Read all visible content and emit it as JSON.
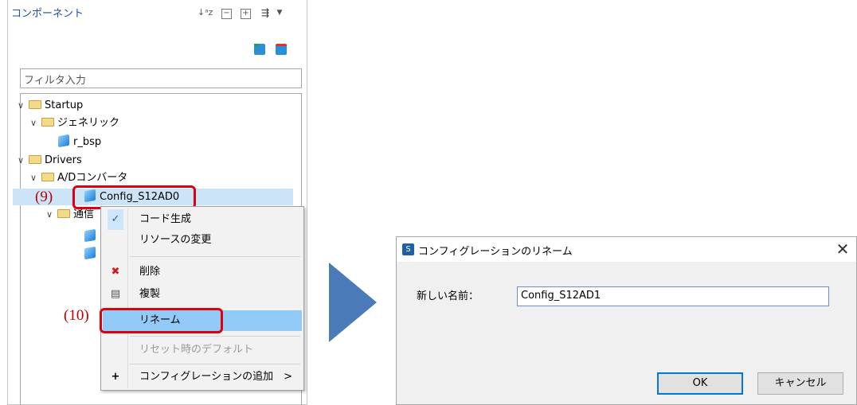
{
  "panel": {
    "title": "コンポーネント",
    "toolbar": {
      "sort_icon": "sort-az-icon",
      "collapse_icon": "collapse-all-icon",
      "expand_icon": "expand-all-icon",
      "filter_icon": "view-menu-icon",
      "dropdown_icon": "chevron-down-icon"
    },
    "add_icon": "add-component-icon",
    "remove_icon": "remove-component-icon",
    "filter_placeholder": "フィルタ入力",
    "tree": [
      {
        "label": "Startup",
        "type": "folder",
        "expanded": true
      },
      {
        "label": "ジェネリック",
        "type": "folder",
        "expanded": true
      },
      {
        "label": "r_bsp",
        "type": "component"
      },
      {
        "label": "Drivers",
        "type": "folder",
        "expanded": true
      },
      {
        "label": "A/Dコンバータ",
        "type": "folder",
        "expanded": true
      },
      {
        "label": "Config_S12AD0",
        "type": "component",
        "selected": true
      },
      {
        "label": "通信",
        "type": "folder",
        "expanded": true
      }
    ]
  },
  "steps": {
    "step9": "(9)",
    "step10": "(10)"
  },
  "context_menu": {
    "items": [
      {
        "label": "コード生成",
        "icon": "check-icon"
      },
      {
        "label": "リソースの変更"
      },
      {
        "label": "削除",
        "icon": "delete-icon"
      },
      {
        "label": "複製",
        "icon": "duplicate-icon"
      },
      {
        "label": "リネーム",
        "highlighted": true
      },
      {
        "label": "リセット時のデフォルト",
        "disabled": true
      },
      {
        "label": "コンフィグレーションの追加",
        "icon": "plus-icon",
        "submenu": ">"
      }
    ]
  },
  "dialog": {
    "title": "コンフィグレーションのリネーム",
    "close": "✕",
    "field_label": "新しい名前：",
    "field_value": "Config_S12AD1",
    "ok": "OK",
    "cancel": "キャンセル"
  },
  "colors": {
    "accent_red": "#e0000d",
    "selection": "#cce4f7",
    "menu_highlight": "#91c9f7",
    "arrow": "#4a7ab8"
  }
}
